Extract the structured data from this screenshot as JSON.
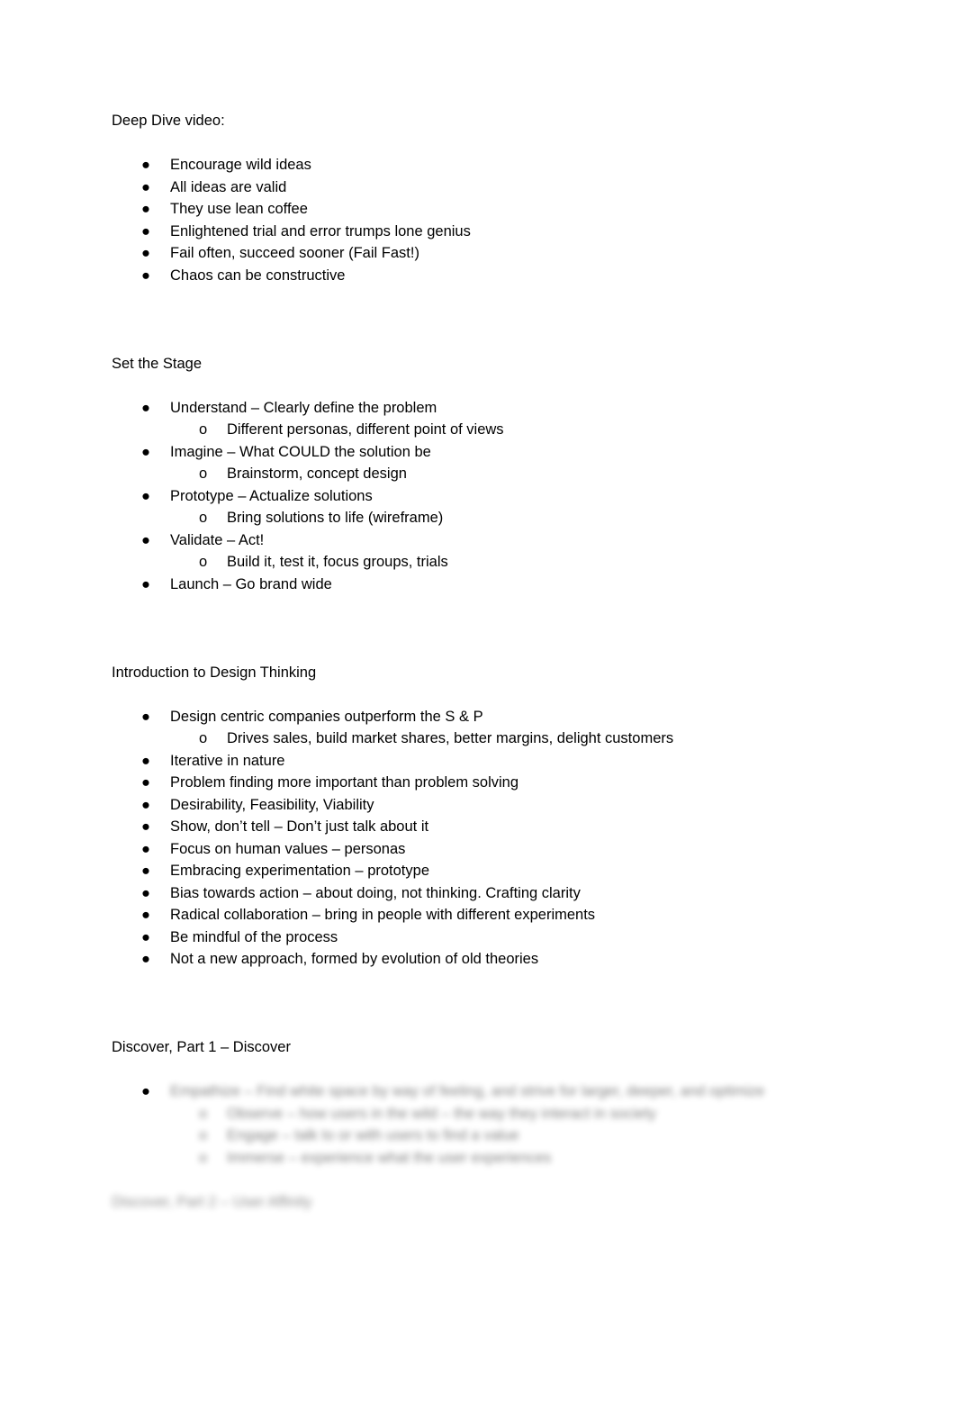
{
  "document": {
    "bullet_glyph": "●",
    "subbullet_glyph": "o",
    "sections": [
      {
        "heading": "Deep Dive video:",
        "bullets": [
          {
            "text": "Encourage wild ideas",
            "sub": []
          },
          {
            "text": "All ideas are valid",
            "sub": []
          },
          {
            "text": "They use lean coffee",
            "sub": []
          },
          {
            "text": "Enlightened trial and error trumps lone genius",
            "sub": []
          },
          {
            "text": "Fail often, succeed sooner (Fail Fast!)",
            "sub": []
          },
          {
            "text": "Chaos can be constructive",
            "sub": []
          }
        ]
      },
      {
        "heading": "Set the Stage",
        "bullets": [
          {
            "text": "Understand – Clearly define the problem",
            "sub": [
              "Different personas, different point of views"
            ]
          },
          {
            "text": "Imagine – What COULD the solution be",
            "sub": [
              "Brainstorm, concept design"
            ]
          },
          {
            "text": "Prototype – Actualize solutions",
            "sub": [
              "Bring solutions to life (wireframe)"
            ]
          },
          {
            "text": "Validate – Act!",
            "sub": [
              "Build it, test it, focus groups, trials"
            ]
          },
          {
            "text": "Launch – Go brand wide",
            "sub": []
          }
        ]
      },
      {
        "heading": "Introduction to Design Thinking",
        "bullets": [
          {
            "text": "Design centric companies outperform the S & P",
            "sub": [
              "Drives sales, build market shares, better margins, delight customers"
            ]
          },
          {
            "text": "Iterative in nature",
            "sub": []
          },
          {
            "text": "Problem finding more important than problem solving",
            "sub": []
          },
          {
            "text": "Desirability, Feasibility, Viability",
            "sub": []
          },
          {
            "text": "Show, don’t tell – Don’t just talk about it",
            "sub": []
          },
          {
            "text": "Focus on human values – personas",
            "sub": []
          },
          {
            "text": "Embracing experimentation – prototype",
            "sub": []
          },
          {
            "text": "Bias towards action – about doing, not thinking.  Crafting clarity",
            "sub": []
          },
          {
            "text": "Radical collaboration – bring in people with different experiments",
            "sub": []
          },
          {
            "text": "Be mindful of the process",
            "sub": []
          },
          {
            "text": "Not a new approach, formed by evolution of old theories",
            "sub": []
          }
        ]
      }
    ],
    "obscured_section": {
      "heading": "Discover, Part 1 – Discover",
      "bullet_text": "Empathize – Find white space by way of feeling, and strive for larger, deeper, and optimize",
      "sub_items": [
        "Observe – how users in the wild – the way they interact in society",
        "Engage – talk to or with users to find a value",
        "Immerse – experience what the user experiences"
      ],
      "trailing_heading": "Discover, Part 2 – User Affinity"
    }
  }
}
